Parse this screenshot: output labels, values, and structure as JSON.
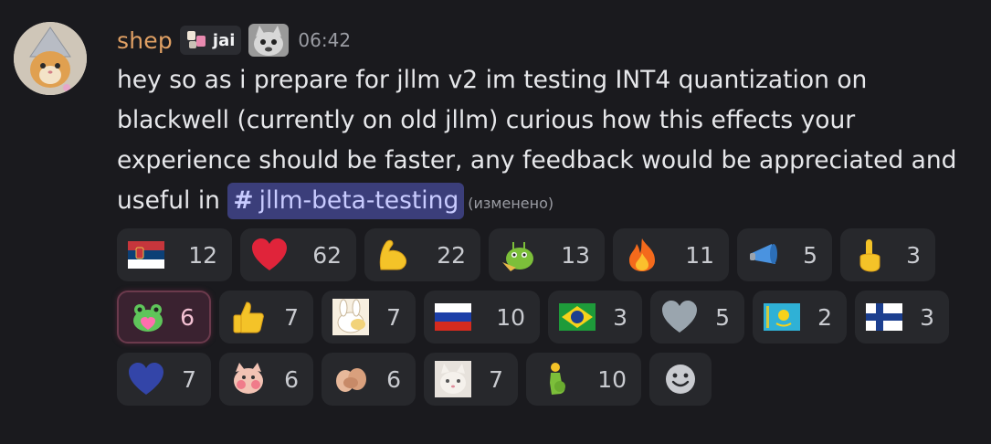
{
  "message": {
    "author": "shep",
    "tag_label": "jai",
    "timestamp": "06:42",
    "text_before": "hey so as i prepare for jllm v2 im testing INT4 quantization on blackwell (currently on old jllm) curious how this effects your experience should be faster, any feedback would be appreciated and useful in ",
    "channel_hash": "#",
    "channel_mention": "jllm-beta-testing",
    "edited_label": "(изменено)"
  },
  "reactions": [
    {
      "emoji": "serbia-flag-emoji",
      "count": "12"
    },
    {
      "emoji": "red-heart-emoji",
      "count": "62"
    },
    {
      "emoji": "flexed-biceps-emoji",
      "count": "22"
    },
    {
      "emoji": "saluting-face-emoji",
      "count": "13"
    },
    {
      "emoji": "fire-emoji",
      "count": "11"
    },
    {
      "emoji": "megaphone-emoji",
      "count": "5"
    },
    {
      "emoji": "point-up-emoji",
      "count": "3"
    },
    {
      "emoji": "frog-heart-emoji",
      "count": "6",
      "active": true
    },
    {
      "emoji": "thumbs-up-emoji",
      "count": "7"
    },
    {
      "emoji": "bunny-sticker-emoji",
      "count": "7"
    },
    {
      "emoji": "russia-flag-emoji",
      "count": "10"
    },
    {
      "emoji": "brazil-flag-emoji",
      "count": "3"
    },
    {
      "emoji": "grey-heart-emoji",
      "count": "5"
    },
    {
      "emoji": "kazakhstan-flag-emoji",
      "count": "2"
    },
    {
      "emoji": "finland-flag-emoji",
      "count": "3"
    },
    {
      "emoji": "blue-heart-emoji",
      "count": "7"
    },
    {
      "emoji": "pig-cat-emoji",
      "count": "6"
    },
    {
      "emoji": "holding-hands-emoji",
      "count": "6"
    },
    {
      "emoji": "cat-face-emoji",
      "count": "7"
    },
    {
      "emoji": "pregnant-man-emoji",
      "count": "10"
    }
  ],
  "add_reaction_icon": "smiley-add-reaction-icon",
  "colors": {
    "background": "#1a1a1e",
    "username": "#e0a064",
    "mention_bg": "#3b3e7a",
    "mention_text": "#c8cbff",
    "reaction_bg": "#27282c"
  }
}
